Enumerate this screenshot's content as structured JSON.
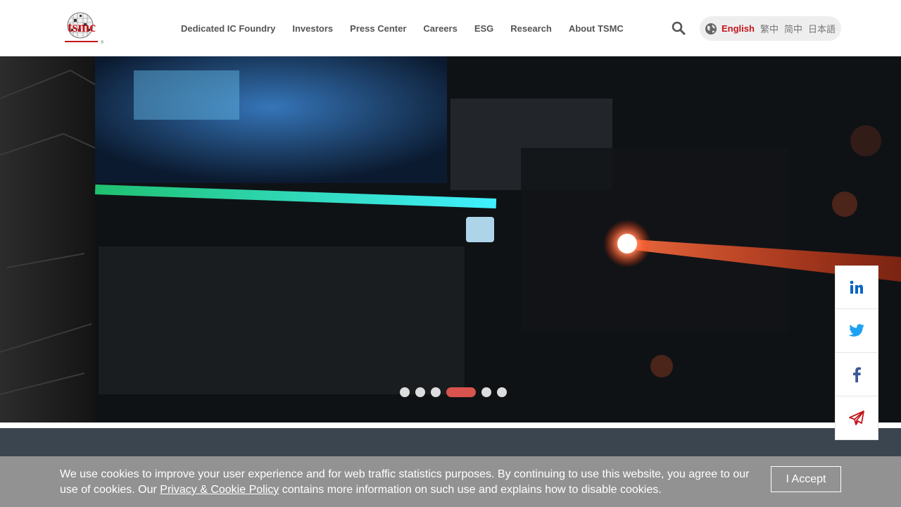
{
  "logo": {
    "text": "tsmc",
    "registered": "®"
  },
  "nav": {
    "items": [
      {
        "label": "Dedicated IC Foundry"
      },
      {
        "label": "Investors"
      },
      {
        "label": "Press Center"
      },
      {
        "label": "Careers"
      },
      {
        "label": "ESG"
      },
      {
        "label": "Research"
      },
      {
        "label": "About TSMC"
      }
    ]
  },
  "search": {
    "icon": "search-icon"
  },
  "language": {
    "icon": "globe-icon",
    "options": [
      "English",
      "繁中",
      "简中",
      "日本語"
    ],
    "selected": "English"
  },
  "carousel": {
    "slide_count": 6,
    "active_index": 3
  },
  "social": {
    "items": [
      {
        "icon": "linkedin-icon",
        "color": "#0a66c2"
      },
      {
        "icon": "twitter-icon",
        "color": "#1da1f2"
      },
      {
        "icon": "facebook-icon",
        "color": "#3b5998"
      },
      {
        "icon": "share-icon",
        "color": "#c4161c"
      }
    ]
  },
  "cookie": {
    "text_before": "We use cookies to improve your user experience and for web traffic statistics purposes. By continuing to use this website, you agree to our use of cookies. Our ",
    "link": "Privacy & Cookie Policy",
    "text_after": " contains more information on such use and explains how to disable cookies.",
    "accept_label": "I Accept"
  },
  "colors": {
    "brand": "#c4161c",
    "band": "#3b4550",
    "dot_active": "#d9534f"
  }
}
